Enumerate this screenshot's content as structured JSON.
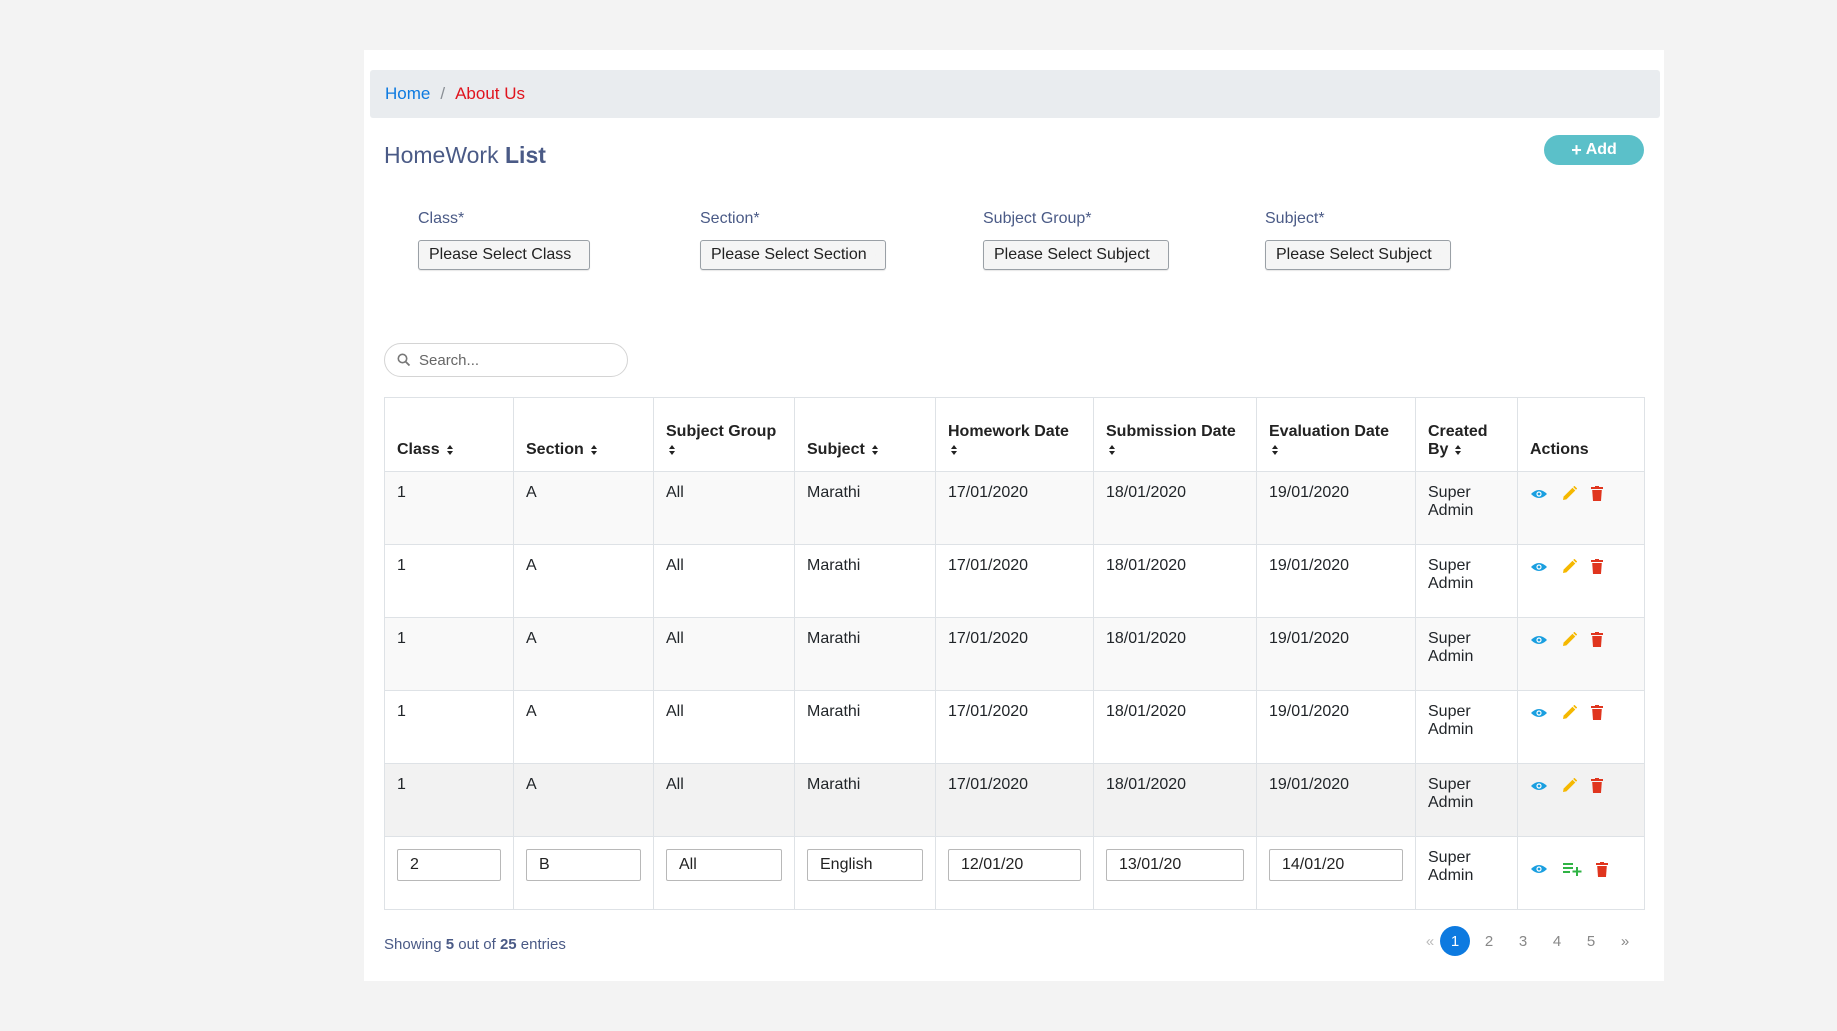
{
  "breadcrumb": {
    "home": "Home",
    "separator": "/",
    "current": "About Us"
  },
  "title": {
    "normal": "HomeWork ",
    "bold": "List"
  },
  "add_button": {
    "label": "Add"
  },
  "filters": [
    {
      "label": "Class*",
      "value": "Please Select Class"
    },
    {
      "label": "Section*",
      "value": "Please Select Section"
    },
    {
      "label": "Subject Group*",
      "value": "Please Select Subject"
    },
    {
      "label": "Subject*",
      "value": "Please Select Subject"
    }
  ],
  "search": {
    "placeholder": "Search..."
  },
  "table": {
    "headers": {
      "class": "Class",
      "section": "Section",
      "subject_group": "Subject Group",
      "subject": "Subject",
      "homework_date": "Homework Date",
      "submission_date": "Submission Date",
      "evaluation_date": "Evaluation Date",
      "created_by": "Created By",
      "actions": "Actions"
    },
    "rows": [
      {
        "class": "1",
        "section": "A",
        "subject_group": "All",
        "subject": "Marathi",
        "homework_date": "17/01/2020",
        "submission_date": "18/01/2020",
        "evaluation_date": "19/01/2020",
        "created_by": "Super Admin"
      },
      {
        "class": "1",
        "section": "A",
        "subject_group": "All",
        "subject": "Marathi",
        "homework_date": "17/01/2020",
        "submission_date": "18/01/2020",
        "evaluation_date": "19/01/2020",
        "created_by": "Super Admin"
      },
      {
        "class": "1",
        "section": "A",
        "subject_group": "All",
        "subject": "Marathi",
        "homework_date": "17/01/2020",
        "submission_date": "18/01/2020",
        "evaluation_date": "19/01/2020",
        "created_by": "Super Admin"
      },
      {
        "class": "1",
        "section": "A",
        "subject_group": "All",
        "subject": "Marathi",
        "homework_date": "17/01/2020",
        "submission_date": "18/01/2020",
        "evaluation_date": "19/01/2020",
        "created_by": "Super Admin"
      },
      {
        "class": "1",
        "section": "A",
        "subject_group": "All",
        "subject": "Marathi",
        "homework_date": "17/01/2020",
        "submission_date": "18/01/2020",
        "evaluation_date": "19/01/2020",
        "created_by": "Super Admin"
      }
    ],
    "edit_row": {
      "class": "2",
      "section": "B",
      "subject_group": "All",
      "subject": "English",
      "homework_date": "12/01/20",
      "submission_date": "13/01/20",
      "evaluation_date": "14/01/20",
      "created_by": "Super Admin"
    }
  },
  "footer": {
    "prefix": "Showing ",
    "shown": "5",
    "middle": " out of ",
    "total": "25",
    "suffix": " entries"
  },
  "pagination": {
    "prev": "«",
    "pages": [
      "1",
      "2",
      "3",
      "4",
      "5"
    ],
    "next": "»"
  },
  "colors": {
    "view": "#1a9fe0",
    "edit": "#f5b800",
    "delete": "#e0351e",
    "add_list": "#2fb344",
    "accent": "#0d7ae0"
  }
}
